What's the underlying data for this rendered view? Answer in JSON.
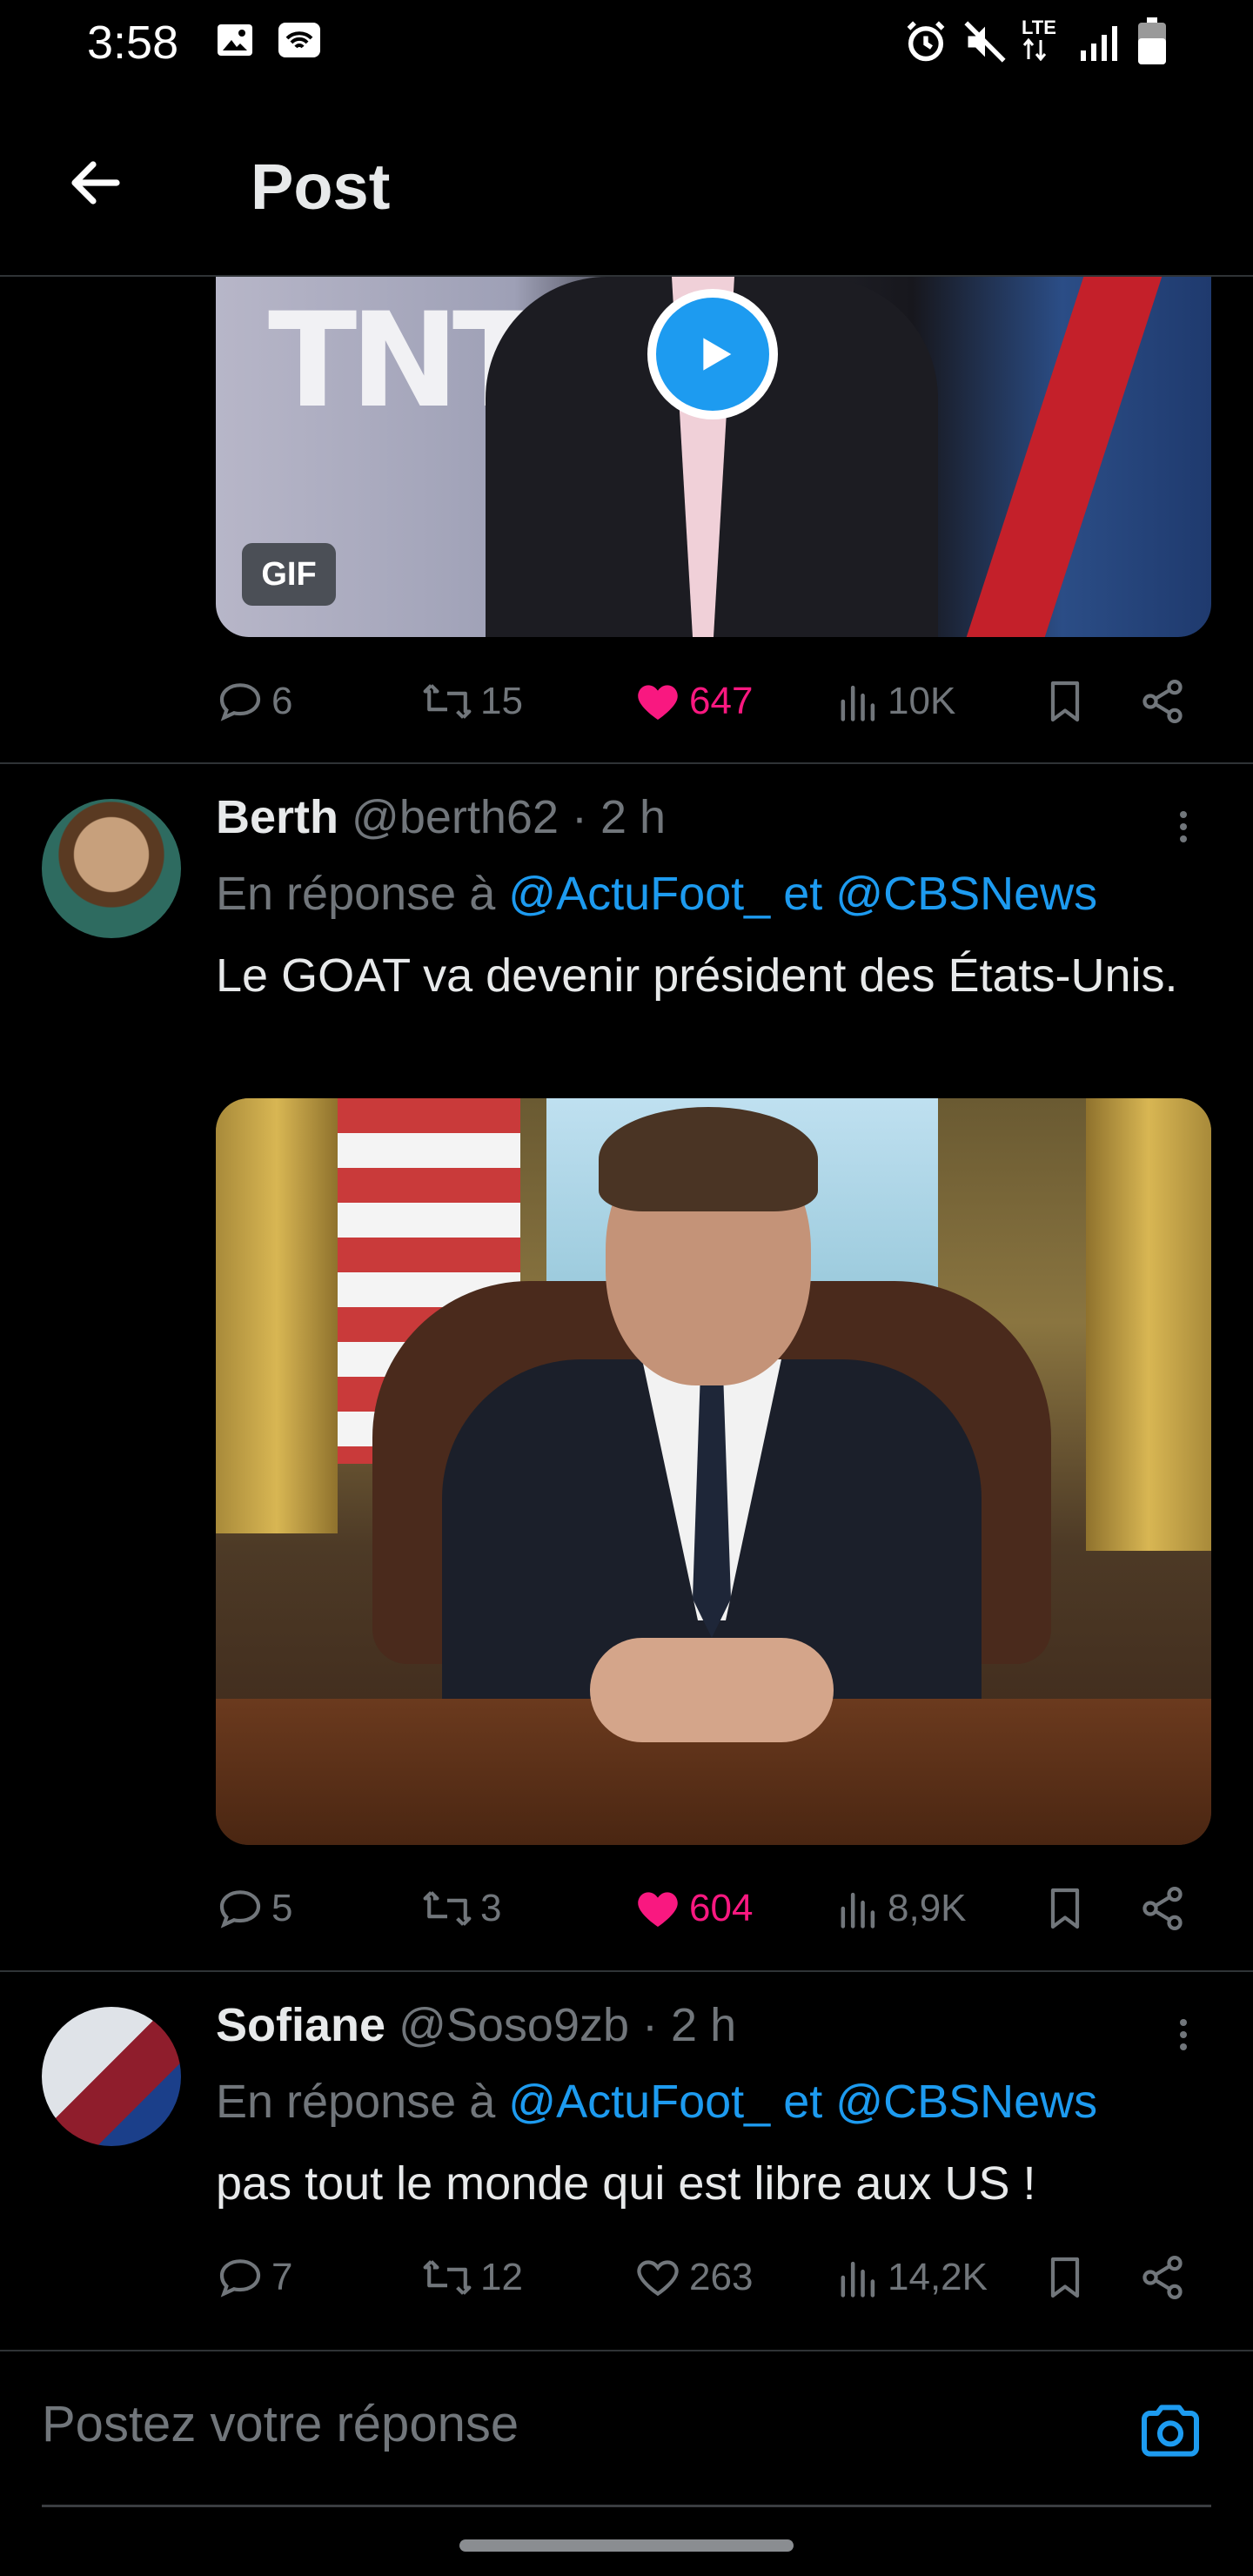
{
  "status_bar": {
    "time": "3:58",
    "network_label": "LTE",
    "left_icons": [
      "image-icon",
      "wifi-calling-icon"
    ],
    "right_icons": [
      "alarm-icon",
      "mute-icon",
      "lte-icon",
      "signal-icon",
      "battery-icon"
    ]
  },
  "header": {
    "title": "Post",
    "back_icon": "arrow-left-icon"
  },
  "colors": {
    "accent": "#1d9bf0",
    "like": "#f91880",
    "muted": "#71767b",
    "background": "#000000",
    "text": "#e7e9ea"
  },
  "tweets": [
    {
      "media": {
        "type": "gif",
        "badge": "GIF"
      },
      "actions": {
        "replies": "6",
        "reposts": "15",
        "likes": "647",
        "liked": true,
        "views": "10K"
      }
    },
    {
      "name": "Berth",
      "handle": "@berth62",
      "separator": "·",
      "time": "2 h",
      "reply_prefix": "En réponse à",
      "reply_to_1": "@ActuFoot_",
      "reply_and": "et",
      "reply_to_2": "@CBSNews",
      "text": "Le GOAT va devenir président des États-Unis.",
      "media": {
        "type": "image"
      },
      "actions": {
        "replies": "5",
        "reposts": "3",
        "likes": "604",
        "liked": true,
        "views": "8,9K"
      }
    },
    {
      "name": "Sofiane",
      "handle": "@Soso9zb",
      "separator": "·",
      "time": "2 h",
      "reply_prefix": "En réponse à",
      "reply_to_1": "@ActuFoot_",
      "reply_and": "et",
      "reply_to_2": "@CBSNews",
      "text": "pas tout le monde qui est libre aux US !",
      "actions": {
        "replies": "7",
        "reposts": "12",
        "likes": "263",
        "liked": false,
        "views": "14,2K"
      }
    }
  ],
  "composer": {
    "placeholder": "Postez votre réponse",
    "camera_icon": "camera-icon"
  }
}
